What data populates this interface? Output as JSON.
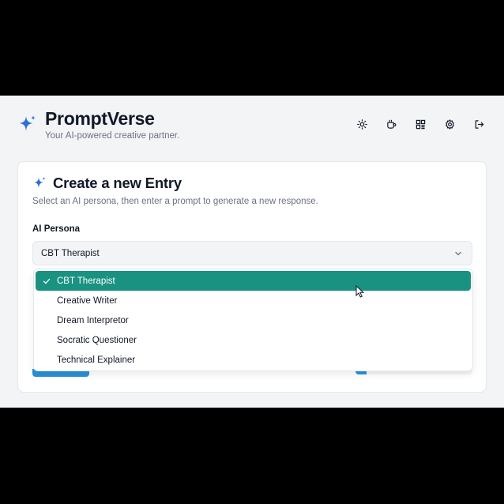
{
  "header": {
    "title": "PromptVerse",
    "subtitle": "Your AI-powered creative partner."
  },
  "toolbar": {
    "icons": [
      "sun-icon",
      "coffee-icon",
      "dashboard-icon",
      "settings-icon",
      "logout-icon"
    ]
  },
  "card": {
    "title": "Create a new Entry",
    "description": "Select an AI persona, then enter a prompt to generate a new response.",
    "persona_label": "AI Persona",
    "selected_value": "CBT Therapist"
  },
  "dropdown": {
    "options": [
      {
        "label": "CBT Therapist",
        "selected": true
      },
      {
        "label": "Creative Writer",
        "selected": false
      },
      {
        "label": "Dream Interpretor",
        "selected": false
      },
      {
        "label": "Socratic Questioner",
        "selected": false
      },
      {
        "label": "Technical Explainer",
        "selected": false
      }
    ]
  },
  "colors": {
    "accent": "#2b6fd9",
    "selected_option": "#1a9281",
    "primary_button": "#2b90d9"
  }
}
